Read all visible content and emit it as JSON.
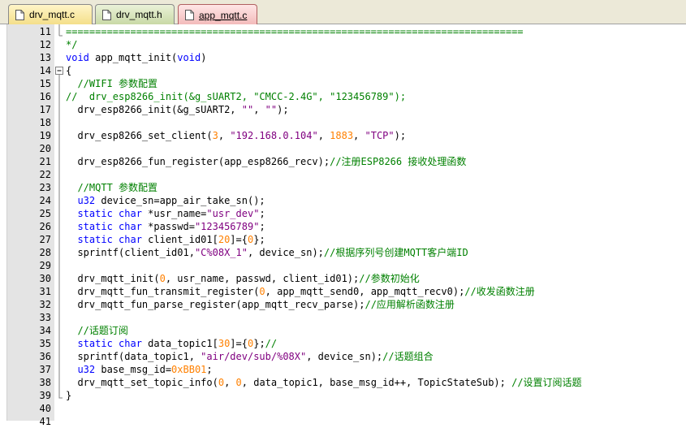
{
  "tabs": [
    {
      "label": "drv_mqtt.c"
    },
    {
      "label": "drv_mqtt.h"
    },
    {
      "label": "app_mqtt.c"
    }
  ],
  "line_numbers": [
    "11",
    "12",
    "13",
    "14",
    "15",
    "16",
    "17",
    "18",
    "19",
    "20",
    "21",
    "22",
    "23",
    "24",
    "25",
    "26",
    "27",
    "28",
    "29",
    "30",
    "31",
    "32",
    "33",
    "34",
    "35",
    "36",
    "37",
    "38",
    "39",
    "40",
    "41"
  ],
  "code": {
    "l11": "==============================================================================",
    "l12": "*/",
    "l13": {
      "kw1": "void",
      "name": " app_mqtt_init(",
      "kw2": "void",
      ")": ")"
    },
    "l14": "{",
    "l15": "  //WIFI 参数配置",
    "l16": {
      "p1": "//  drv_esp8266_init(&g_sUART2, ",
      "s1": "\"CMCC-2.4G\"",
      "p2": ", ",
      "s2": "\"123456789\"",
      "p3": ");"
    },
    "l17": {
      "p1": "  drv_esp8266_init(&g_sUART2, ",
      "s1": "\"\"",
      "p2": ", ",
      "s2": "\"\"",
      "p3": ");"
    },
    "l19": {
      "p1": "  drv_esp8266_set_client(",
      "n1": "3",
      "p2": ", ",
      "s1": "\"192.168.0.104\"",
      "p3": ", ",
      "n2": "1883",
      "p4": ", ",
      "s2": "\"TCP\"",
      "p5": ");"
    },
    "l21": {
      "p1": "  drv_esp8266_fun_register(app_esp8266_recv);",
      "c1": "//注册ESP8266 接收处理函数"
    },
    "l23": "  //MQTT 参数配置",
    "l24": {
      "k1": "  u32",
      "p1": " device_sn=app_air_take_sn();"
    },
    "l25": {
      "k1": "  static",
      "k2": " char",
      "p1": " *usr_name=",
      "s1": "\"usr_dev\"",
      "p2": ";"
    },
    "l26": {
      "k1": "  static",
      "k2": " char",
      "p1": " *passwd=",
      "s1": "\"123456789\"",
      "p2": ";"
    },
    "l27": {
      "k1": "  static",
      "k2": " char",
      "p1": " client_id01[",
      "n1": "20",
      "p2": "]={",
      "n2": "0",
      "p3": "};"
    },
    "l28": {
      "p1": "  sprintf(client_id01,",
      "s1": "\"C%08X_1\"",
      "p2": ", device_sn);",
      "c1": "//根据序列号创建MQTT客户端ID"
    },
    "l30": {
      "p1": "  drv_mqtt_init(",
      "n1": "0",
      "p2": ", usr_name, passwd, client_id01);",
      "c1": "//参数初始化"
    },
    "l31": {
      "p1": "  drv_mqtt_fun_transmit_register(",
      "n1": "0",
      "p2": ", app_mqtt_send0, app_mqtt_recv0);",
      "c1": "//收发函数注册"
    },
    "l32": {
      "p1": "  drv_mqtt_fun_parse_register(app_mqtt_recv_parse);",
      "c1": "//应用解析函数注册"
    },
    "l34": "  //话题订阅",
    "l35": {
      "k1": "  static",
      "k2": " char",
      "p1": " data_topic1[",
      "n1": "30",
      "p2": "]={",
      "n2": "0",
      "p3": "};",
      "c1": "//"
    },
    "l36": {
      "p1": "  sprintf(data_topic1, ",
      "s1": "\"air/dev/sub/%08X\"",
      "p2": ", device_sn);",
      "c1": "//话题组合"
    },
    "l37": {
      "k1": "  u32",
      "p1": " base_msg_id=",
      "n1": "0xBB01",
      "p2": ";"
    },
    "l38": {
      "p1": "  drv_mqtt_set_topic_info(",
      "n1": "0",
      "p2": ", ",
      "n2": "0",
      "p3": ", data_topic1, base_msg_id++, TopicStateSub); ",
      "c1": "//设置订阅话题"
    },
    "l39": "}"
  },
  "colors": {
    "keyword": "#0000ff",
    "string": "#800080",
    "number": "#ff8000",
    "comment": "#008000"
  }
}
